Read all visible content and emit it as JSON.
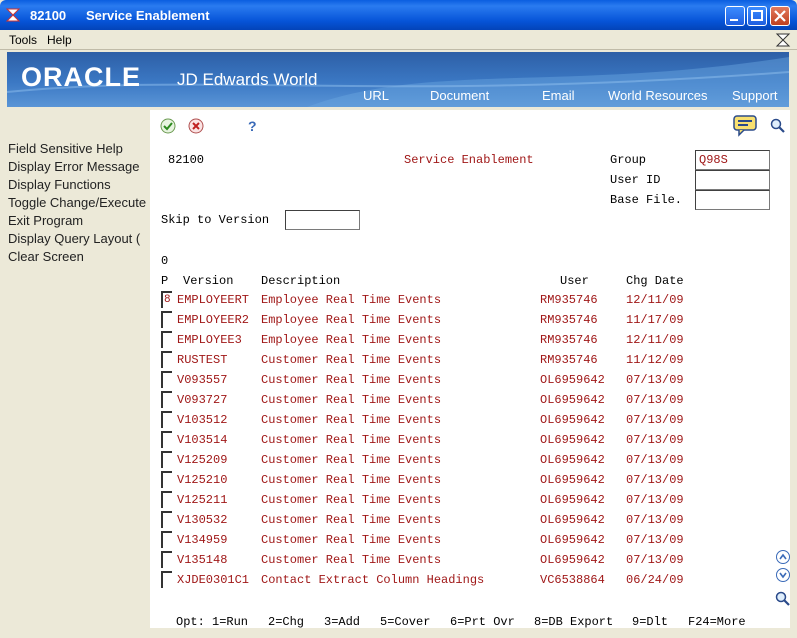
{
  "window": {
    "code": "82100",
    "title": "Service Enablement"
  },
  "menu": {
    "tools": "Tools",
    "help": "Help"
  },
  "banner": {
    "oracle": "ORACLE",
    "product": "JD Edwards World",
    "links": [
      "URL",
      "Document",
      "Email",
      "World Resources",
      "Support"
    ]
  },
  "exits": [
    "Field Sensitive Help",
    "Display Error Message",
    "Display Functions",
    "Toggle Change/Execute",
    "Exit Program",
    "Display Query Layout (",
    "Clear Screen"
  ],
  "form": {
    "program": "82100",
    "title": "Service Enablement",
    "group_label": "Group",
    "group_value": "Q98S",
    "userid_label": "User ID",
    "userid_value": "",
    "basefile_label": "Base File.",
    "basefile_value": "",
    "skip_label": "Skip to Version",
    "skip_value": "",
    "zero": "0"
  },
  "grid": {
    "headers": {
      "p": "P",
      "version": "Version",
      "description": "Description",
      "user": "User",
      "chgdate": "Chg Date"
    },
    "rows": [
      {
        "sel": "8",
        "version": "EMPLOYEERT",
        "description": "Employee Real Time Events",
        "user": "RM935746",
        "date": "12/11/09"
      },
      {
        "sel": "",
        "version": "EMPLOYEER2",
        "description": "Employee Real Time Events",
        "user": "RM935746",
        "date": "11/17/09"
      },
      {
        "sel": "",
        "version": "EMPLOYEE3",
        "description": "Employee Real Time Events",
        "user": "RM935746",
        "date": "12/11/09"
      },
      {
        "sel": "",
        "version": "RUSTEST",
        "description": "Customer Real Time Events",
        "user": "RM935746",
        "date": "11/12/09"
      },
      {
        "sel": "",
        "version": "V093557",
        "description": "Customer Real Time Events",
        "user": "OL6959642",
        "date": "07/13/09"
      },
      {
        "sel": "",
        "version": "V093727",
        "description": "Customer Real Time Events",
        "user": "OL6959642",
        "date": "07/13/09"
      },
      {
        "sel": "",
        "version": "V103512",
        "description": "Customer Real Time Events",
        "user": "OL6959642",
        "date": "07/13/09"
      },
      {
        "sel": "",
        "version": "V103514",
        "description": "Customer Real Time Events",
        "user": "OL6959642",
        "date": "07/13/09"
      },
      {
        "sel": "",
        "version": "V125209",
        "description": "Customer Real Time Events",
        "user": "OL6959642",
        "date": "07/13/09"
      },
      {
        "sel": "",
        "version": "V125210",
        "description": "Customer Real Time Events",
        "user": "OL6959642",
        "date": "07/13/09"
      },
      {
        "sel": "",
        "version": "V125211",
        "description": "Customer Real Time Events",
        "user": "OL6959642",
        "date": "07/13/09"
      },
      {
        "sel": "",
        "version": "V130532",
        "description": "Customer Real Time Events",
        "user": "OL6959642",
        "date": "07/13/09"
      },
      {
        "sel": "",
        "version": "V134959",
        "description": "Customer Real Time Events",
        "user": "OL6959642",
        "date": "07/13/09"
      },
      {
        "sel": "",
        "version": "V135148",
        "description": "Customer Real Time Events",
        "user": "OL6959642",
        "date": "07/13/09"
      },
      {
        "sel": "",
        "version": "XJDE0301C1",
        "description": "Contact Extract Column Headings",
        "user": "VC6538864",
        "date": "06/24/09"
      }
    ]
  },
  "options": [
    "Opt: 1=Run",
    "2=Chg",
    "3=Add",
    "5=Cover",
    "6=Prt Ovr",
    "8=DB Export",
    "9=Dlt",
    "F24=More"
  ],
  "icons": {
    "ok": "check-icon",
    "cancel": "cancel-icon",
    "help": "help-icon",
    "chat": "chat-icon",
    "search": "magnifier-icon"
  },
  "colors": {
    "field_text": "#a01818",
    "banner": "#3b78c4",
    "titlebar": "#0a5ee0"
  }
}
